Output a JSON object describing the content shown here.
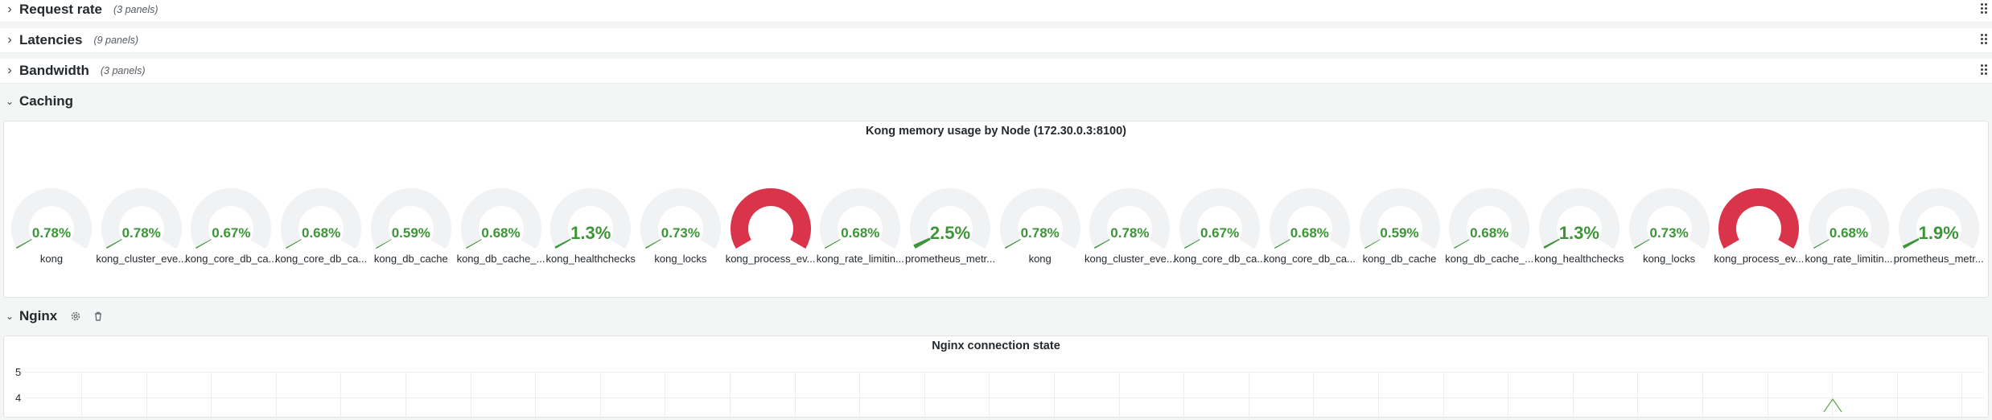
{
  "rows": {
    "request_rate": {
      "title": "Request rate",
      "count": "(3 panels)"
    },
    "latencies": {
      "title": "Latencies",
      "count": "(9 panels)"
    },
    "bandwidth": {
      "title": "Bandwidth",
      "count": "(3 panels)"
    },
    "caching": {
      "title": "Caching"
    },
    "nginx": {
      "title": "Nginx"
    }
  },
  "caching_panel": {
    "title": "Kong memory usage by Node (172.30.0.3:8100)",
    "gauges": [
      {
        "label": "kong",
        "value": "0.78%",
        "pct": 0.78
      },
      {
        "label": "kong_cluster_eve...",
        "value": "0.78%",
        "pct": 0.78
      },
      {
        "label": "kong_core_db_ca...",
        "value": "0.67%",
        "pct": 0.67
      },
      {
        "label": "kong_core_db_ca...",
        "value": "0.68%",
        "pct": 0.68
      },
      {
        "label": "kong_db_cache",
        "value": "0.59%",
        "pct": 0.59
      },
      {
        "label": "kong_db_cache_...",
        "value": "0.68%",
        "pct": 0.68
      },
      {
        "label": "kong_healthchecks",
        "value": "1.3%",
        "pct": 1.3
      },
      {
        "label": "kong_locks",
        "value": "0.73%",
        "pct": 0.73
      },
      {
        "label": "kong_process_ev...",
        "value": "100%",
        "pct": 100
      },
      {
        "label": "kong_rate_limitin...",
        "value": "0.68%",
        "pct": 0.68
      },
      {
        "label": "prometheus_metr...",
        "value": "2.5%",
        "pct": 2.5
      },
      {
        "label": "kong",
        "value": "0.78%",
        "pct": 0.78
      },
      {
        "label": "kong_cluster_eve...",
        "value": "0.78%",
        "pct": 0.78
      },
      {
        "label": "kong_core_db_ca...",
        "value": "0.67%",
        "pct": 0.67
      },
      {
        "label": "kong_core_db_ca...",
        "value": "0.68%",
        "pct": 0.68
      },
      {
        "label": "kong_db_cache",
        "value": "0.59%",
        "pct": 0.59
      },
      {
        "label": "kong_db_cache_...",
        "value": "0.68%",
        "pct": 0.68
      },
      {
        "label": "kong_healthchecks",
        "value": "1.3%",
        "pct": 1.3
      },
      {
        "label": "kong_locks",
        "value": "0.73%",
        "pct": 0.73
      },
      {
        "label": "kong_process_ev...",
        "value": "100%",
        "pct": 100
      },
      {
        "label": "kong_rate_limitin...",
        "value": "0.68%",
        "pct": 0.68
      },
      {
        "label": "prometheus_metr...",
        "value": "1.9%",
        "pct": 1.9
      }
    ]
  },
  "nginx_panel": {
    "title": "Nginx connection state",
    "y_ticks": [
      "5",
      "4"
    ]
  },
  "colors": {
    "ok": "#3e9438",
    "warn": "#f2b233",
    "critical": "#d9344a",
    "track": "#f1f2f4"
  },
  "icons": {
    "row_collapsed": "chevron-right-icon",
    "row_expanded": "chevron-down-icon",
    "settings": "gear-icon",
    "delete": "trash-icon",
    "drag": "drag-handle-icon"
  }
}
